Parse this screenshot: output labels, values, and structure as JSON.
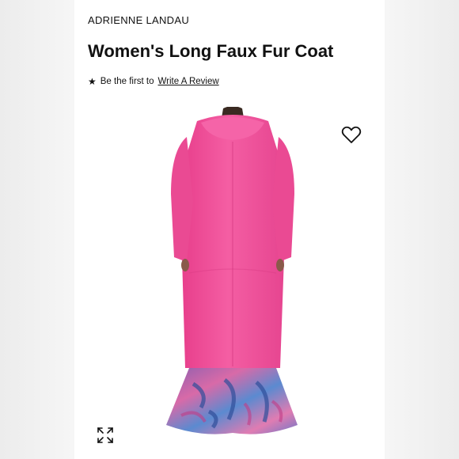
{
  "product": {
    "brand": "ADRIENNE LANDAU",
    "title": "Women's Long Faux Fur Coat"
  },
  "reviews": {
    "prompt": "Be the first to",
    "link_label": "Write A Review"
  },
  "icons": {
    "star": "star-icon",
    "favorite": "heart-icon",
    "expand": "expand-icon"
  },
  "colors": {
    "coat": "#f0529a",
    "text": "#111111"
  }
}
